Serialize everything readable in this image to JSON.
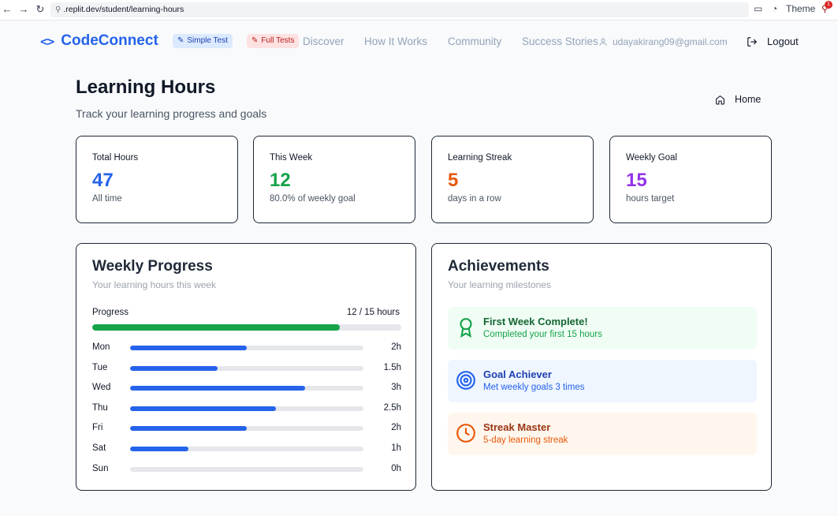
{
  "browser": {
    "url": ".replit.dev/student/learning-hours",
    "theme_label": "Theme",
    "notification_count": "1"
  },
  "nav": {
    "brand": "CodeConnect",
    "simple_test": "Simple Test",
    "full_tests": "Full Tests",
    "links": [
      "Discover",
      "How It Works",
      "Community",
      "Success Stories"
    ],
    "user_email": "udayakirang09@gmail.com",
    "logout": "Logout"
  },
  "header": {
    "title": "Learning Hours",
    "subtitle": "Track your learning progress and goals",
    "home": "Home"
  },
  "stats": [
    {
      "label": "Total Hours",
      "value": "47",
      "sub": "All time",
      "color": "#2563eb"
    },
    {
      "label": "This Week",
      "value": "12",
      "sub": "80.0% of weekly goal",
      "color": "#16a34a"
    },
    {
      "label": "Learning Streak",
      "value": "5",
      "sub": "days in a row",
      "color": "#ea580c"
    },
    {
      "label": "Weekly Goal",
      "value": "15",
      "sub": "hours target",
      "color": "#9333ea"
    }
  ],
  "weekly": {
    "title": "Weekly Progress",
    "subtitle": "Your learning hours this week",
    "progress_label": "Progress",
    "progress_value": "12 / 15 hours",
    "progress_fraction": 0.8,
    "max_hours": 4,
    "days": [
      {
        "day": "Mon",
        "hours": 2,
        "label": "2h"
      },
      {
        "day": "Tue",
        "hours": 1.5,
        "label": "1.5h"
      },
      {
        "day": "Wed",
        "hours": 3,
        "label": "3h"
      },
      {
        "day": "Thu",
        "hours": 2.5,
        "label": "2.5h"
      },
      {
        "day": "Fri",
        "hours": 2,
        "label": "2h"
      },
      {
        "day": "Sat",
        "hours": 1,
        "label": "1h"
      },
      {
        "day": "Sun",
        "hours": 0,
        "label": "0h"
      }
    ]
  },
  "achievements": {
    "title": "Achievements",
    "subtitle": "Your learning milestones",
    "items": [
      {
        "title": "First Week Complete!",
        "desc": "Completed your first 15 hours",
        "icon": "award-icon",
        "bg": "#f0fdf4",
        "title_color": "#166534",
        "desc_color": "#16a34a"
      },
      {
        "title": "Goal Achiever",
        "desc": "Met weekly goals 3 times",
        "icon": "target-icon",
        "bg": "#eff6ff",
        "title_color": "#1e40af",
        "desc_color": "#2563eb"
      },
      {
        "title": "Streak Master",
        "desc": "5-day learning streak",
        "icon": "clock-icon",
        "bg": "#fff7ed",
        "title_color": "#9a3412",
        "desc_color": "#ea580c"
      }
    ]
  }
}
